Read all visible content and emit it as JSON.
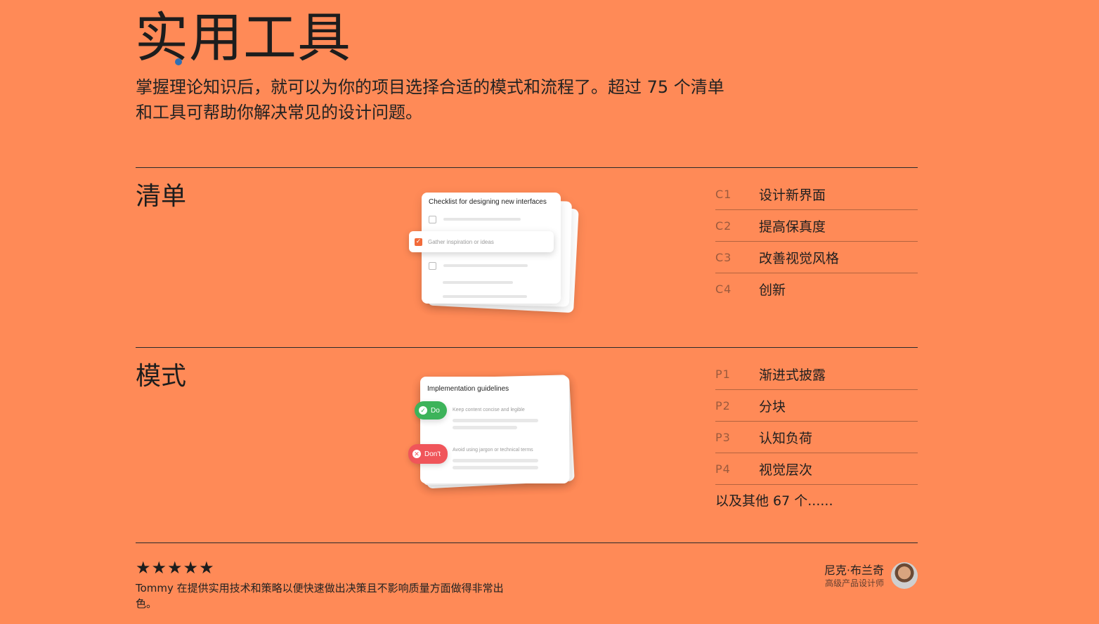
{
  "header": {
    "title": "实用工具",
    "intro": "掌握理论知识后，就可以为你的项目选择合适的模式和流程了。超过 75 个清单和工具可帮助你解决常见的设计问题。"
  },
  "checklists": {
    "title": "清单",
    "illustration": {
      "card_title": "Checklist for designing new interfaces",
      "checked_item": "Gather inspiration or ideas",
      "accent_color": "#F26B3A"
    },
    "items": [
      {
        "code": "C1",
        "label": "设计新界面"
      },
      {
        "code": "C2",
        "label": "提高保真度"
      },
      {
        "code": "C3",
        "label": "改善视觉风格"
      },
      {
        "code": "C4",
        "label": "创新"
      }
    ]
  },
  "patterns": {
    "title": "模式",
    "illustration": {
      "card_title": "Implementation guidelines",
      "do_label": "Do",
      "do_text": "Keep content concise and legible",
      "dont_label": "Don't",
      "dont_text": "Avoid using jargon or technical terms",
      "do_color": "#3DB35A",
      "dont_color": "#F0555A"
    },
    "items": [
      {
        "code": "P1",
        "label": "渐进式披露"
      },
      {
        "code": "P2",
        "label": "分块"
      },
      {
        "code": "P3",
        "label": "认知负荷"
      },
      {
        "code": "P4",
        "label": "视觉层次"
      }
    ],
    "more": "以及其他 67 个......"
  },
  "review": {
    "stars": "★★★★★",
    "quote": "Tommy 在提供实用技术和策略以便快速做出决策且不影响质量方面做得非常出色。",
    "name": "尼克·布兰奇",
    "role": "高级产品设计师"
  },
  "theme": {
    "background": "#FF8A57"
  }
}
